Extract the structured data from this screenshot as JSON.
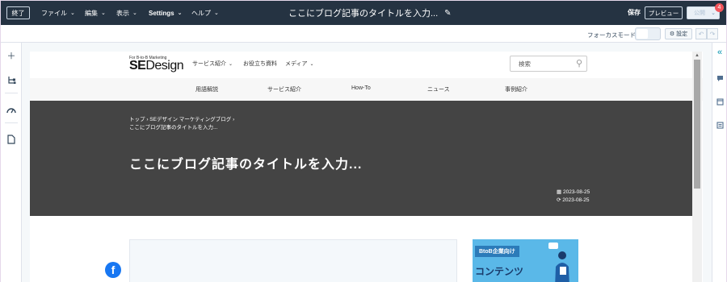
{
  "topbar": {
    "exit_label": "終了",
    "menus": [
      {
        "label": "ファイル"
      },
      {
        "label": "編集"
      },
      {
        "label": "表示"
      },
      {
        "label": "Settings"
      },
      {
        "label": "ヘルプ"
      }
    ],
    "title": "ここにブログ記事のタイトルを入力...",
    "save_label": "保存",
    "preview_label": "プレビュー",
    "publish_label": "公開",
    "badge_count": "4"
  },
  "subbar": {
    "focus_mode_label": "フォーカスモード",
    "settings_label": "設定"
  },
  "site": {
    "logo_tagline": "For B-to-B Marketing",
    "logo_se": "SE",
    "logo_design": "Design",
    "nav": [
      {
        "label": "サービス紹介",
        "caret": true
      },
      {
        "label": "お役立ち資料",
        "caret": false
      },
      {
        "label": "メディア",
        "caret": true
      }
    ],
    "search_placeholder": "検索",
    "categories": [
      "用語解説",
      "サービス紹介",
      "How-To",
      "ニュース",
      "事例紹介"
    ],
    "breadcrumb": {
      "home": "トップ",
      "blog": "SEデザイン マーケティングブログ",
      "current": "ここにブログ記事のタイトルを入力..."
    },
    "hero_title": "ここにブログ記事のタイトルを入力...",
    "published_date": "2023-08-25",
    "updated_date": "2023-08-25",
    "ad": {
      "tag": "BtoB企業向け",
      "title": "コンテンツ"
    }
  },
  "colors": {
    "topbar_bg": "#253342",
    "hero_bg": "#444444",
    "accent": "#0091ae",
    "badge": "#f2545b",
    "facebook": "#1877f2",
    "ad_bg": "#5ab8e8"
  }
}
